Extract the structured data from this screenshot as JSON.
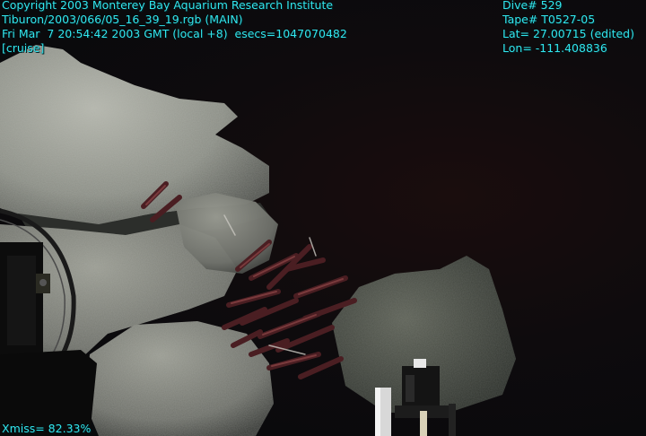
{
  "overlay": {
    "copyright": "Copyright 2003 Monterey Bay Aquarium Research Institute",
    "file": "Tiburon/2003/066/05_16_39_19.rgb (MAIN)",
    "datetime": "Fri Mar  7 20:54:42 2003 GMT (local +8)  esecs=1047070482",
    "mode": "[cruise]",
    "dive": "Dive# 529",
    "tape": "Tape# T0527-05",
    "lat": "Lat= 27.00715 (edited)",
    "lon": "Lon= -111.408836",
    "xmiss": "Xmiss= 82.33%"
  },
  "colors": {
    "overlay_text": "#33e6ee",
    "water": "#0e0b0d",
    "rock": "#8a8d85",
    "tubeworm": "#4a1e22"
  }
}
